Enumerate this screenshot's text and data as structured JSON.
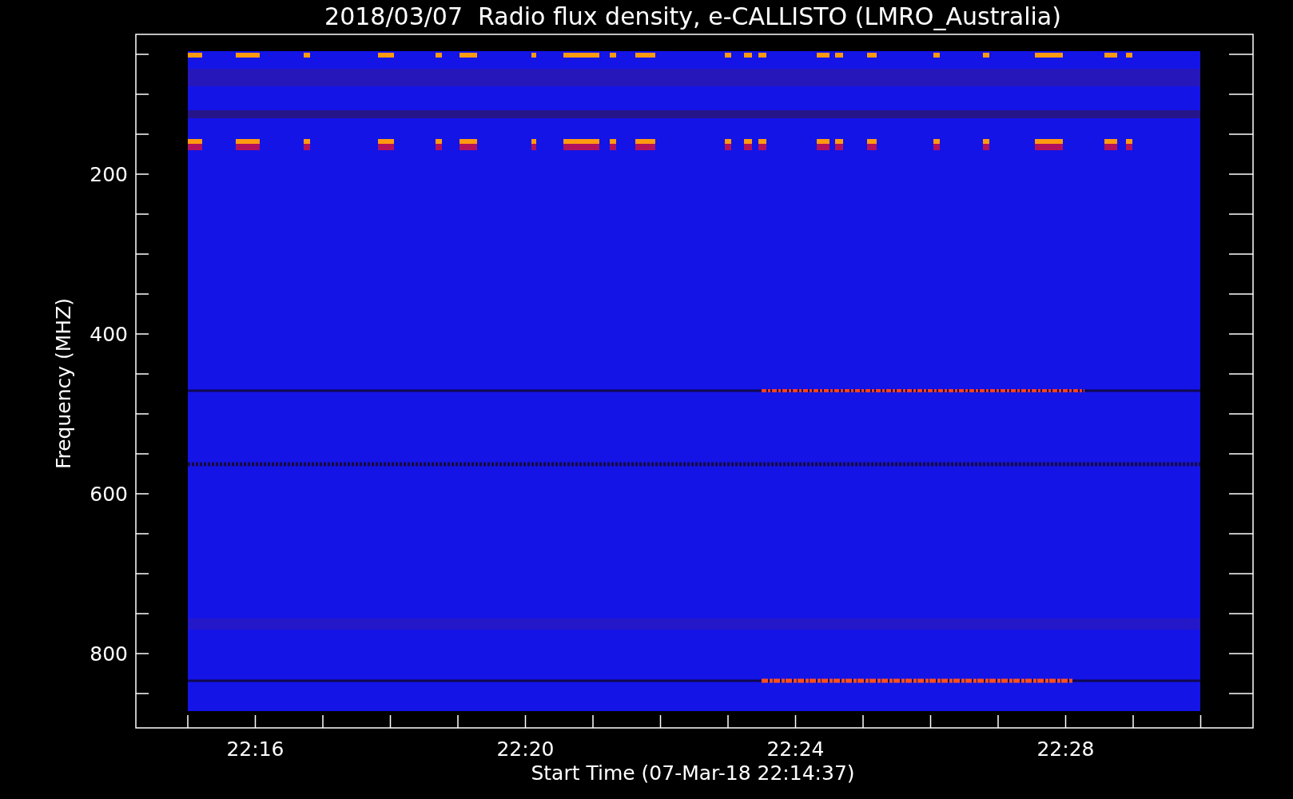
{
  "title": "2018/03/07  Radio flux density, e-CALLISTO (LMRO_Australia)",
  "y_axis": {
    "label": "Frequency (MHZ)",
    "tick_labels": [
      "200",
      "400",
      "600",
      "800"
    ]
  },
  "x_axis": {
    "label": "Start Time (07-Mar-18 22:14:37)",
    "tick_labels": [
      "22:16",
      "22:20",
      "22:24",
      "22:28"
    ]
  }
}
